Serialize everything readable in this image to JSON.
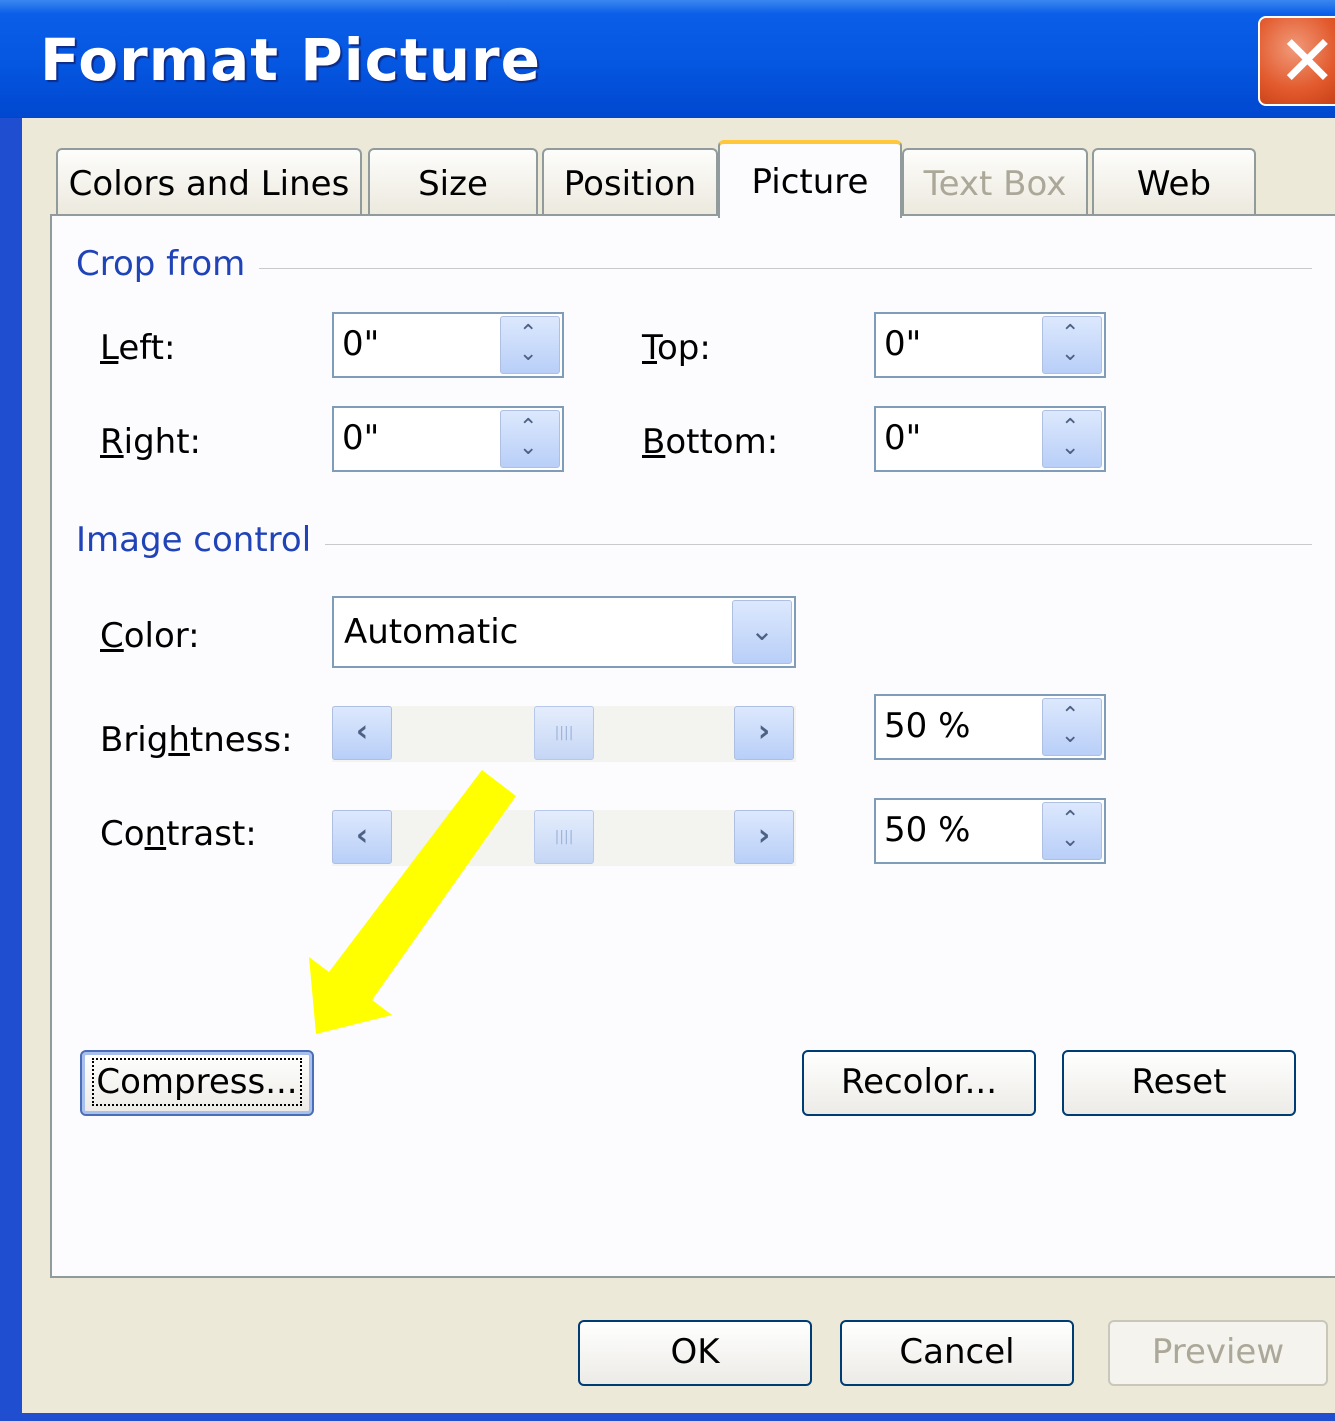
{
  "window": {
    "title": "Format Picture"
  },
  "tabs": [
    {
      "label": "Colors and Lines",
      "state": "normal"
    },
    {
      "label": "Size",
      "state": "normal"
    },
    {
      "label": "Position",
      "state": "normal"
    },
    {
      "label": "Picture",
      "state": "active"
    },
    {
      "label": "Text Box",
      "state": "disabled"
    },
    {
      "label": "Web",
      "state": "normal"
    }
  ],
  "crop": {
    "section_label": "Crop from",
    "left": {
      "label": "Left:",
      "value": "0\""
    },
    "right": {
      "label": "Right:",
      "value": "0\""
    },
    "top": {
      "label": "Top:",
      "value": "0\""
    },
    "bottom": {
      "label": "Bottom:",
      "value": "0\""
    }
  },
  "image_control": {
    "section_label": "Image control",
    "color": {
      "label": "Color:",
      "value": "Automatic"
    },
    "brightness": {
      "label": "Brightness:",
      "value": "50 %",
      "level": 0.5
    },
    "contrast": {
      "label": "Contrast:",
      "value": "50 %",
      "level": 0.5
    }
  },
  "buttons": {
    "compress": "Compress...",
    "recolor": "Recolor...",
    "reset": "Reset",
    "ok": "OK",
    "cancel": "Cancel",
    "preview": "Preview"
  },
  "colors": {
    "title_bar": "#0556e0",
    "close_button": "#e25a2d",
    "group_label": "#2044b8",
    "annotation_arrow": "#ffff00",
    "active_tab_highlight": "#ffc83c"
  },
  "icons": {
    "close": "close-x-icon",
    "spin": "spin-up-down-arrows-icon",
    "dropdown": "chevron-down-icon",
    "slider_left": "chevron-left-icon",
    "slider_right": "chevron-right-icon",
    "annotation": "yellow-arrow-pointing-to-compress"
  }
}
